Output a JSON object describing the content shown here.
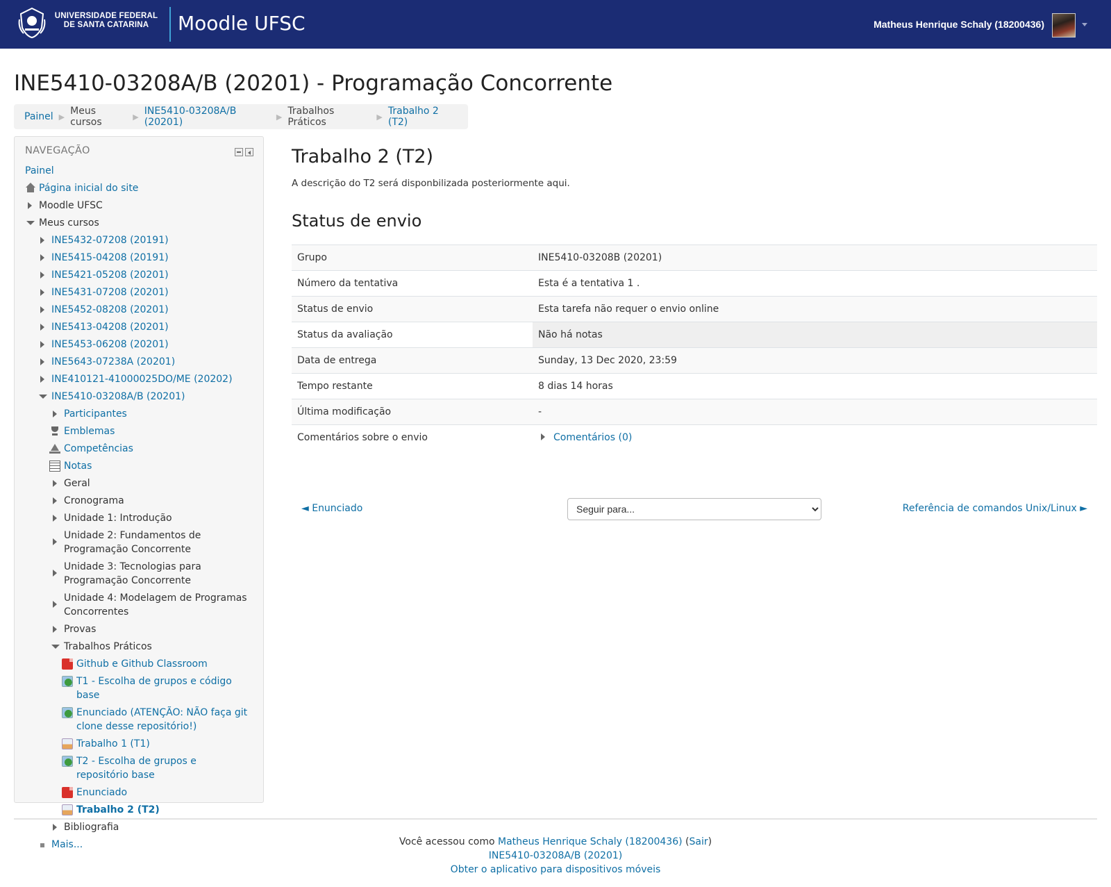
{
  "header": {
    "university": "UNIVERSIDADE FEDERAL DE SANTA CATARINA",
    "site_name": "Moodle UFSC",
    "user_name": "Matheus Henrique Schaly (18200436)",
    "brand_color": "#1b2c74"
  },
  "page": {
    "title": "INE5410-03208A/B (20201) - Programação Concorrente"
  },
  "breadcrumb": [
    {
      "label": "Painel"
    },
    {
      "label": "Meus cursos"
    },
    {
      "label": "INE5410-03208A/B (20201)"
    },
    {
      "label": "Trabalhos Práticos"
    },
    {
      "label": "Trabalho 2 (T2)"
    }
  ],
  "navigation": {
    "heading": "NAVEGAÇÃO",
    "items": [
      {
        "label": "Painel"
      },
      {
        "label": "Página inicial do site",
        "icon": "home-icon"
      },
      {
        "label": "Moodle UFSC"
      },
      {
        "label": "Meus cursos"
      },
      {
        "label": "INE5432-07208 (20191)"
      },
      {
        "label": "INE5415-04208 (20191)"
      },
      {
        "label": "INE5421-05208 (20201)"
      },
      {
        "label": "INE5431-07208 (20201)"
      },
      {
        "label": "INE5452-08208 (20201)"
      },
      {
        "label": "INE5413-04208 (20201)"
      },
      {
        "label": "INE5453-06208 (20201)"
      },
      {
        "label": "INE5643-07238A (20201)"
      },
      {
        "label": "INE410121-41000025DO/ME (20202)"
      },
      {
        "label": "INE5410-03208A/B (20201)"
      },
      {
        "label": "Participantes"
      },
      {
        "label": "Emblemas",
        "icon": "trophy-icon"
      },
      {
        "label": "Competências",
        "icon": "competency-icon"
      },
      {
        "label": "Notas",
        "icon": "grades-icon"
      },
      {
        "label": "Geral"
      },
      {
        "label": "Cronograma"
      },
      {
        "label": "Unidade 1: Introdução"
      },
      {
        "label": "Unidade 2: Fundamentos de Programação Concorrente"
      },
      {
        "label": "Unidade 3: Tecnologias para Programação Concorrente"
      },
      {
        "label": "Unidade 4: Modelagem de Programas Concorrentes"
      },
      {
        "label": "Provas"
      },
      {
        "label": "Trabalhos Práticos"
      },
      {
        "label": "Github e Github Classroom",
        "icon": "pdf-icon"
      },
      {
        "label": "T1 - Escolha de grupos e código base",
        "icon": "url-icon"
      },
      {
        "label": "Enunciado (ATENÇÃO: NÃO faça git clone desse repositório!)",
        "icon": "url-icon"
      },
      {
        "label": "Trabalho 1 (T1)",
        "icon": "assignment-icon"
      },
      {
        "label": "T2 - Escolha de grupos e repositório base",
        "icon": "url-icon"
      },
      {
        "label": "Enunciado",
        "icon": "pdf-icon"
      },
      {
        "label": "Trabalho 2 (T2)",
        "icon": "assignment-icon"
      },
      {
        "label": "Bibliografia"
      },
      {
        "label": "Mais..."
      }
    ]
  },
  "main": {
    "title": "Trabalho 2 (T2)",
    "description": "A descrição do T2 será disponbilizada posteriormente aqui.",
    "status_heading": "Status de envio",
    "rows": [
      {
        "label": "Grupo",
        "value": "INE5410-03208B (20201)"
      },
      {
        "label": "Número da tentativa",
        "value": "Esta é a tentativa 1 ."
      },
      {
        "label": "Status de envio",
        "value": "Esta tarefa não requer o envio online"
      },
      {
        "label": "Status da avaliação",
        "value": "Não há notas"
      },
      {
        "label": "Data de entrega",
        "value": "Sunday, 13 Dec 2020, 23:59"
      },
      {
        "label": "Tempo restante",
        "value": "8 dias 14 horas"
      },
      {
        "label": "Última modificação",
        "value": "-"
      },
      {
        "label": "Comentários sobre o envio",
        "value": "Comentários (0)"
      }
    ]
  },
  "activity_nav": {
    "prev": "◄ Enunciado",
    "jump_placeholder": "Seguir para...",
    "next": "Referência de comandos Unix/Linux ►"
  },
  "footer": {
    "logged_prefix": "Você acessou como",
    "user_name": "Matheus Henrique Schaly (18200436)",
    "logout": "Sair",
    "course": "INE5410-03208A/B (20201)",
    "mobile_app": "Obter o aplicativo para dispositivos móveis"
  }
}
